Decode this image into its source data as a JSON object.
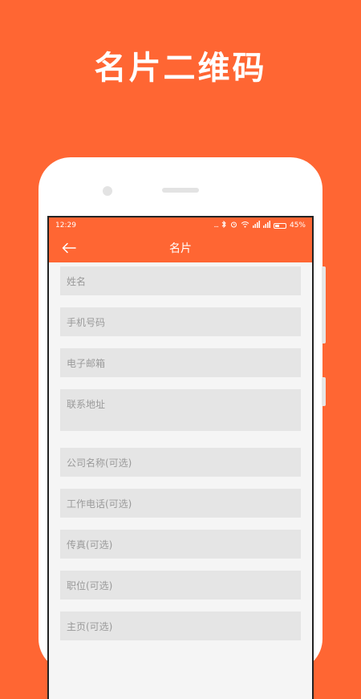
{
  "headline": "名片二维码",
  "status_bar": {
    "time": "12:29",
    "dots": "...",
    "battery_text": "45%",
    "battery_level": 0.45,
    "icons": [
      "bluetooth-icon",
      "alarm-icon",
      "wifi-icon",
      "signal-icon",
      "signal-icon",
      "battery-icon"
    ]
  },
  "nav": {
    "title": "名片",
    "back_icon": "arrow-left-icon"
  },
  "form": {
    "fields": [
      {
        "placeholder": "姓名"
      },
      {
        "placeholder": "手机号码"
      },
      {
        "placeholder": "电子邮箱"
      },
      {
        "placeholder": "联系地址"
      },
      {
        "placeholder": "公司名称(可选)"
      },
      {
        "placeholder": "工作电话(可选)"
      },
      {
        "placeholder": "传真(可选)"
      },
      {
        "placeholder": "职位(可选)"
      },
      {
        "placeholder": "主页(可选)"
      }
    ]
  },
  "colors": {
    "brand": "#FF6633",
    "field_bg": "#E5E5E5",
    "screen_bg": "#F5F5F5",
    "placeholder": "#9A9A9A"
  }
}
